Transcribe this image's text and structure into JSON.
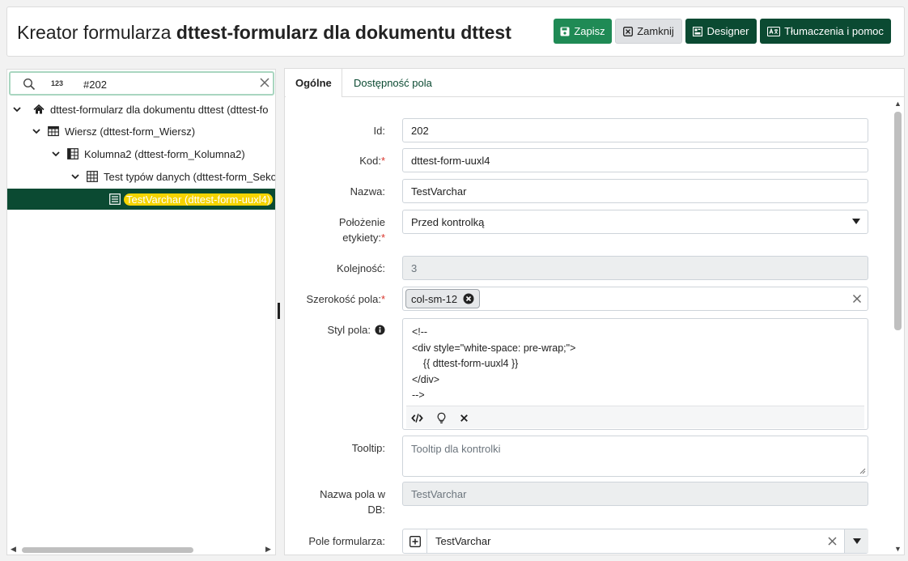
{
  "header": {
    "title_prefix": "Kreator formularza ",
    "title_bold": "dttest-formularz dla dokumentu dttest",
    "buttons": {
      "save": "Zapisz",
      "close": "Zamknij",
      "designer": "Designer",
      "translations": "Tłumaczenia i pomoc"
    }
  },
  "search": {
    "num_label": "123",
    "value": "#202"
  },
  "tree": {
    "items": [
      {
        "label": "dttest-formularz dla dokumentu dttest (dttest-fo",
        "icon": "home-icon"
      },
      {
        "label": "Wiersz (dttest-form_Wiersz)",
        "icon": "table-icon"
      },
      {
        "label": "Kolumna2 (dttest-form_Kolumna2)",
        "icon": "column-icon"
      },
      {
        "label": "Test typów danych (dttest-form_Seko",
        "icon": "grid-icon"
      },
      {
        "label": "TestVarchar (dttest-form-uuxl4)",
        "icon": "field-icon",
        "selected": true
      }
    ]
  },
  "tabs": {
    "general": "Ogólne",
    "access": "Dostępność pola"
  },
  "form": {
    "id": {
      "label": "Id:",
      "value": "202"
    },
    "code": {
      "label": "Kod:",
      "required": "*",
      "value": "dttest-form-uuxl4"
    },
    "name": {
      "label": "Nazwa:",
      "value": "TestVarchar"
    },
    "label_position": {
      "label_line1": "Położenie",
      "label_line2": "etykiety:",
      "required": "*",
      "value": "Przed kontrolką"
    },
    "order": {
      "label": "Kolejność:",
      "value": "3"
    },
    "width": {
      "label": "Szerokość pola:",
      "required": "*",
      "chip": "col-sm-12"
    },
    "style": {
      "label": "Styl pola:",
      "lines": [
        "<!--",
        "<div style=\"white-space: pre-wrap;\">",
        "    {{ dttest-form-uuxl4 }}",
        "</div>",
        "-->"
      ]
    },
    "tooltip": {
      "label": "Tooltip:",
      "placeholder": "Tooltip dla kontrolki"
    },
    "db_name": {
      "label_line1": "Nazwa pola w",
      "label_line2": "DB:",
      "value": "TestVarchar"
    },
    "form_field": {
      "label": "Pole formularza:",
      "value": "TestVarchar"
    }
  },
  "colors": {
    "primary_dark": "#0b4a32",
    "save_green": "#1f8a55",
    "highlight": "#f5d400",
    "required": "#d9342b"
  }
}
